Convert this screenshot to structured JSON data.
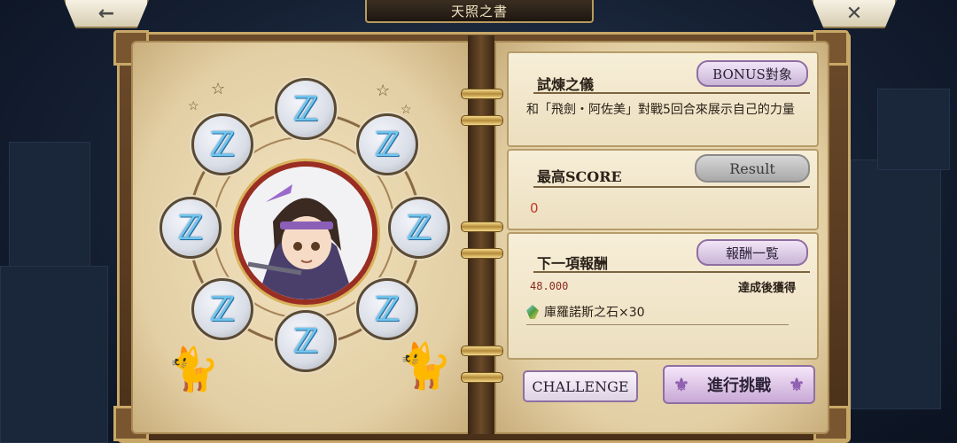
{
  "header": {
    "back_icon": "arrow-left-icon",
    "back_glyph": "←",
    "close_icon": "close-icon",
    "close_glyph": "✕",
    "title": "天照之書"
  },
  "emblem": {
    "runes": [
      "ℤ",
      "ℤ",
      "ℤ",
      "ℤ",
      "ℤ",
      "ℤ",
      "ℤ",
      "ℤ"
    ],
    "portrait_icon": "character-portrait-icon"
  },
  "trial": {
    "title": "試煉之儀",
    "bonus_button": "BONUS對象",
    "description": "和「飛劍・阿佐美」對戰5回合來展示自己的力量"
  },
  "score": {
    "title": "最高SCORE",
    "result_button": "Result",
    "value": "0"
  },
  "reward": {
    "title": "下一項報酬",
    "list_button": "報酬一覧",
    "threshold": "48.000",
    "condition": "達成後獲得",
    "item_icon": "crystal-stone-icon",
    "item": "庫羅諾斯之石×30"
  },
  "actions": {
    "challenge": "CHALLENGE",
    "start": "進行挑戰"
  },
  "colors": {
    "accent_purple": "#8e6fa3",
    "score_red": "#c0392b",
    "rune_blue": "#6fc6ef"
  }
}
